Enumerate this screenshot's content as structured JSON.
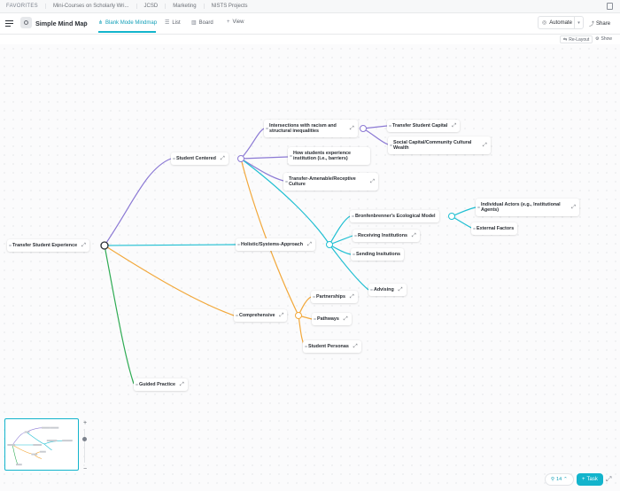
{
  "favorites": {
    "label": "FAVORITES",
    "items": [
      "Mini-Courses on Scholarly Wri...",
      "JCSD",
      "Marketing",
      "NISTS Projects"
    ]
  },
  "header": {
    "title": "Simple Mind Map",
    "tabs": [
      {
        "label": "Blank Mode Mindmap",
        "icon": "mindmap-icon",
        "active": true
      },
      {
        "label": "List",
        "icon": "list-icon",
        "active": false
      },
      {
        "label": "Board",
        "icon": "board-icon",
        "active": false
      },
      {
        "label": "View",
        "icon": "plus-icon",
        "active": false
      }
    ],
    "automate_label": "Automate",
    "share_label": "Share"
  },
  "toolbar": {
    "relayout_label": "Re-Layout",
    "show_label": "Show"
  },
  "mindmap": {
    "root": "Transfer Student Experience",
    "nodes": {
      "student_centered": "Student Centered",
      "intersections": "Intersections with racism and structural inequalities",
      "transfer_capital": "Transfer Student Capital",
      "social_capital": "Social Capital/Community Cultural Wealth",
      "barriers": "How students experience institution (i.e., barriers)",
      "receptive_culture": "Transfer-Amenable/Receptive Culture",
      "holistic": "Holistic/Systems-Approach",
      "bronfenbrenner": "Bronfenbrenner's Ecological Model",
      "individual_actors": "Individual Actors (e.g., Institutional Agents)",
      "external_factors": "External Factors",
      "receiving": "Receiving Institutions",
      "sending": "Sending Insitutions",
      "advising": "Advising",
      "comprehensive": "Comprehensive",
      "partnerships": "Partnerships",
      "pathways": "Pathways",
      "personas": "Student Personas",
      "guided_practice": "Guided Practice"
    },
    "colors": {
      "purple": "#8b79d4",
      "teal": "#1fbfd2",
      "orange": "#f2a83b",
      "green": "#2eab53"
    }
  },
  "footer": {
    "tasks_count": "14",
    "task_button_label": "Task"
  }
}
